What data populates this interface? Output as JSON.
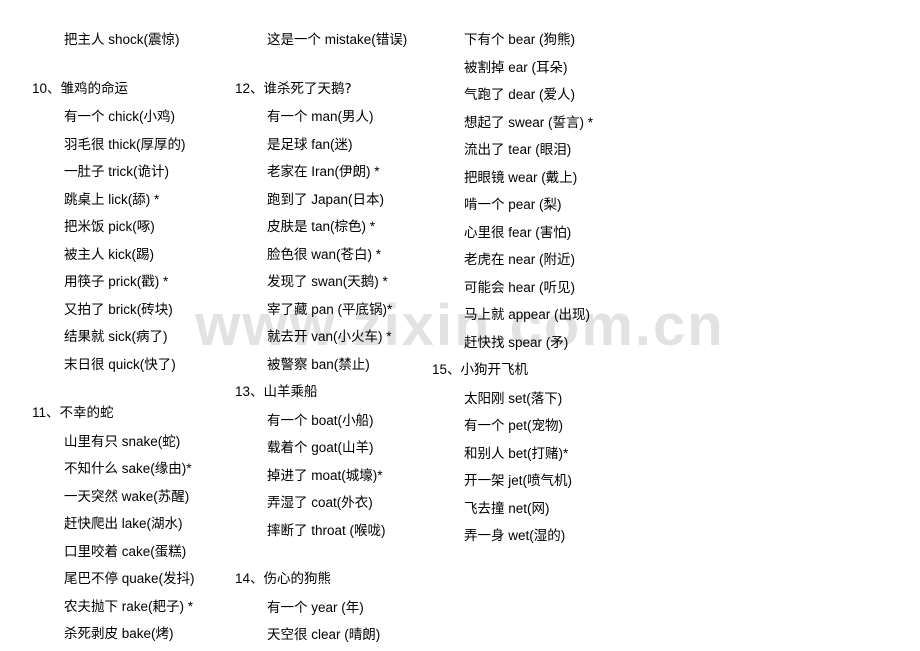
{
  "watermark": {
    "text": "www.zixin.com.cn"
  },
  "document": {
    "columns": [
      {
        "id": "column-1",
        "blocks": [
          {
            "type": "lines",
            "lines": [
              "把主人 shock(震惊)"
            ]
          },
          {
            "type": "group",
            "number": "10、",
            "title": "雏鸡的命运",
            "lines": [
              "有一个 chick(小鸡)",
              "羽毛很 thick(厚厚的)",
              "一肚子 trick(诡计)",
              "跳桌上 lick(舔) *",
              "把米饭 pick(啄)",
              "被主人 kick(踢)",
              "用筷子 prick(戳) *",
              "又拍了 brick(砖块)",
              "结果就 sick(病了)",
              "末日很 quick(快了)"
            ]
          },
          {
            "type": "group",
            "number": "11、",
            "title": "不幸的蛇",
            "lines": [
              "山里有只 snake(蛇)",
              "不知什么 sake(缘由)*",
              "一天突然 wake(苏醒)",
              "赶快爬出 lake(湖水)",
              "口里咬着 cake(蛋糕)",
              "尾巴不停 quake(发抖)",
              "农夫抛下 rake(耙子) *",
              "杀死剥皮 bake(烤)"
            ]
          }
        ]
      },
      {
        "id": "column-2",
        "blocks": [
          {
            "type": "lines",
            "lines": [
              "这是一个 mistake(错误)"
            ]
          },
          {
            "type": "group",
            "number": "12、",
            "title": "谁杀死了天鹅?",
            "lines": [
              "有一个 man(男人)",
              "是足球 fan(迷)",
              "老家在 Iran(伊朗) *",
              "跑到了 Japan(日本)",
              "皮肤是 tan(棕色) *",
              "脸色很 wan(苍白) *",
              "发现了 swan(天鹅) *",
              "宰了藏 pan (平底锅)*",
              "就去开 van(小火车) *",
              "被警察 ban(禁止)"
            ]
          },
          {
            "type": "group",
            "number": "13、",
            "title": "山羊乘船",
            "lines": [
              "有一个 boat(小船)",
              "载着个 goat(山羊)",
              "掉进了 moat(城壕)*",
              "弄湿了 coat(外衣)",
              "摔断了 throat (喉咙)"
            ]
          },
          {
            "type": "group",
            "number": "14、",
            "title": "伤心的狗熊",
            "lines": [
              "有一个 year (年)",
              "天空很 clear (晴朗)"
            ]
          }
        ]
      },
      {
        "id": "column-3",
        "blocks": [
          {
            "type": "lines",
            "lines": [
              "下有个 bear (狗熊)",
              "被割掉 ear (耳朵)",
              "气跑了 dear (爱人)",
              "想起了 swear (誓言) *",
              "流出了 tear (眼泪)",
              "把眼镜 wear (戴上)",
              "啃一个 pear (梨)",
              "心里很 fear (害怕)",
              "老虎在 near (附近)",
              "可能会 hear (听见)",
              "马上就 appear (出现)",
              "赶快找 spear (矛)"
            ]
          },
          {
            "type": "group",
            "number": "15、",
            "title": "小狗开飞机",
            "lines": [
              "太阳刚 set(落下)",
              "有一个 pet(宠物)",
              "和别人 bet(打赌)*",
              "开一架 jet(喷气机)",
              "飞去撞 net(网)",
              "弄一身 wet(湿的)"
            ]
          }
        ]
      }
    ]
  }
}
